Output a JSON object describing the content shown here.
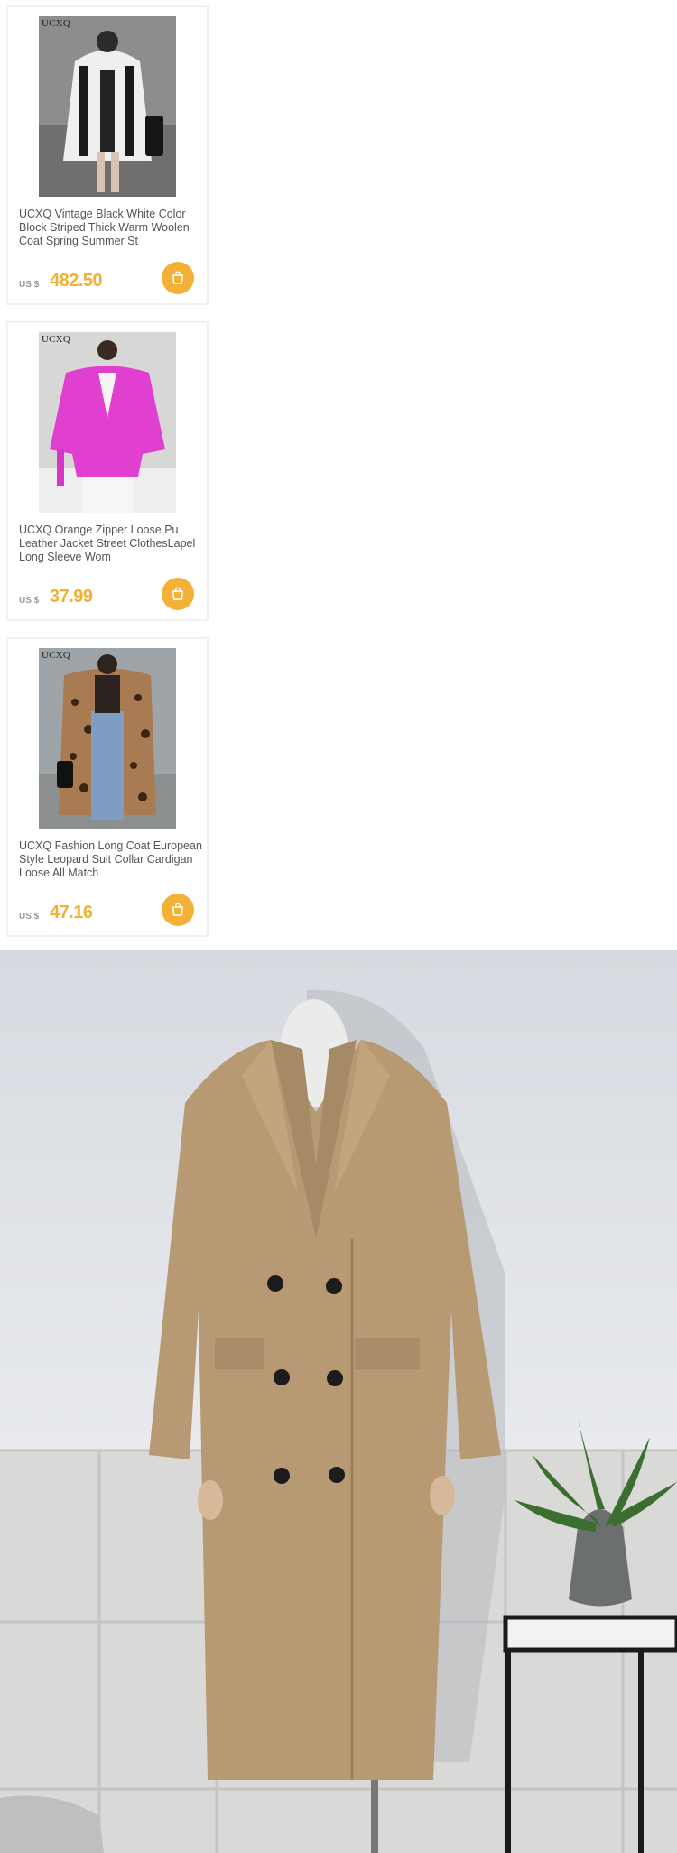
{
  "products": [
    {
      "brand": "UCXQ",
      "title": "UCXQ Vintage Black White Color Block Striped Thick Warm Woolen Coat Spring Summer St",
      "currency": "US $",
      "price": "482.50",
      "image": "striped-coat-photo"
    },
    {
      "brand": "UCXQ",
      "title": "UCXQ Orange Zipper Loose Pu Leather Jacket Street ClothesLapel Long Sleeve Wom",
      "currency": "US $",
      "price": "37.99",
      "image": "pink-leather-jacket-photo"
    },
    {
      "brand": "UCXQ",
      "title": "UCXQ Fashion Long Coat European Style Leopard Suit Collar Cardigan Loose All Match",
      "currency": "US $",
      "price": "47.16",
      "image": "leopard-coat-photo"
    }
  ],
  "colors": {
    "price": "#f3b133",
    "cart_button": "#f3b237",
    "title_text": "#555555"
  },
  "hero": {
    "image": "camel-double-breasted-long-coat-photo"
  }
}
